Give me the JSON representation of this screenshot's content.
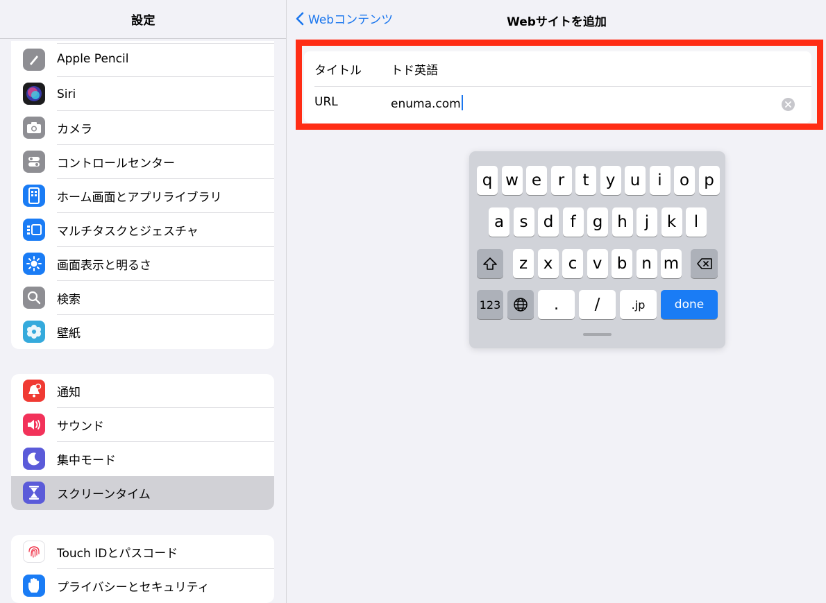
{
  "sidebar": {
    "title": "設定",
    "groups": [
      {
        "items": [
          {
            "label": "Apple Pencil",
            "icon": "pencil-icon",
            "color": "#8e8e93"
          },
          {
            "label": "Siri",
            "icon": "siri-icon",
            "color": "#1c1c1e"
          },
          {
            "label": "カメラ",
            "icon": "camera-icon",
            "color": "#8e8e93"
          },
          {
            "label": "コントロールセンター",
            "icon": "toggles-icon",
            "color": "#8e8e93"
          },
          {
            "label": "ホーム画面とアプリライブラリ",
            "icon": "home-screen-icon",
            "color": "#1a7cf5"
          },
          {
            "label": "マルチタスクとジェスチャ",
            "icon": "multitask-icon",
            "color": "#1a7cf5"
          },
          {
            "label": "画面表示と明るさ",
            "icon": "brightness-icon",
            "color": "#1a7cf5"
          },
          {
            "label": "検索",
            "icon": "search-icon",
            "color": "#8e8e93"
          },
          {
            "label": "壁紙",
            "icon": "wallpaper-icon",
            "color": "#35aadc"
          }
        ]
      },
      {
        "items": [
          {
            "label": "通知",
            "icon": "notification-icon",
            "color": "#f03a33"
          },
          {
            "label": "サウンド",
            "icon": "sound-icon",
            "color": "#f2325a"
          },
          {
            "label": "集中モード",
            "icon": "moon-icon",
            "color": "#5b5bd9"
          },
          {
            "label": "スクリーンタイム",
            "icon": "hourglass-icon",
            "color": "#5b5bd9",
            "selected": true
          }
        ]
      },
      {
        "items": [
          {
            "label": "Touch IDとパスコード",
            "icon": "fingerprint-icon",
            "color": "#ffffff"
          },
          {
            "label": "プライバシーとセキュリティ",
            "icon": "hand-icon",
            "color": "#1a7cf5"
          }
        ]
      }
    ]
  },
  "nav": {
    "back_label": "Webコンテンツ",
    "title": "Webサイトを追加"
  },
  "form": {
    "title_label": "タイトル",
    "title_value": "トド英語",
    "url_label": "URL",
    "url_value": "enuma.com"
  },
  "keyboard": {
    "row1": [
      "q",
      "w",
      "e",
      "r",
      "t",
      "y",
      "u",
      "i",
      "o",
      "p"
    ],
    "row2": [
      "a",
      "s",
      "d",
      "f",
      "g",
      "h",
      "j",
      "k",
      "l"
    ],
    "row3": [
      "z",
      "x",
      "c",
      "v",
      "b",
      "n",
      "m"
    ],
    "numbers_label": "123",
    "dot_label": ".",
    "slash_label": "/",
    "domain_label": ".jp",
    "done_label": "done"
  },
  "colors": {
    "accent": "#1a76ee",
    "highlight_border": "#ff2d15",
    "done_key": "#1a7cf5"
  }
}
